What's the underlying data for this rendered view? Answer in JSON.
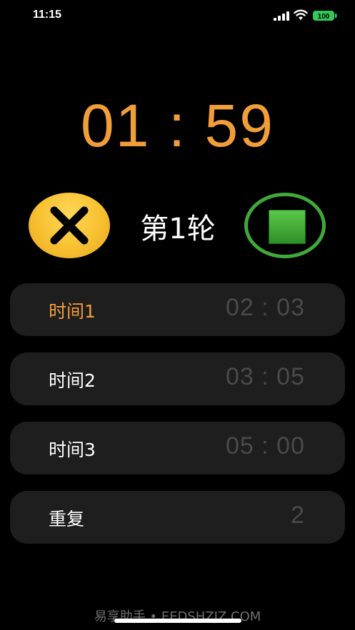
{
  "status_bar": {
    "time": "11:15",
    "battery_level": "100",
    "battery_color": "#34C759"
  },
  "timer": {
    "display": "01 : 59",
    "color": "#F29E38"
  },
  "round": {
    "label": "第1轮"
  },
  "controls": {
    "cancel_icon": "close-icon",
    "stop_icon": "stop-square-icon",
    "stop_color": "#3FA93A"
  },
  "settings": [
    {
      "label": "时间1",
      "value": "02 : 03",
      "active": true
    },
    {
      "label": "时间2",
      "value": "03 : 05",
      "active": false
    },
    {
      "label": "时间3",
      "value": "05 : 00",
      "active": false
    },
    {
      "label": "重复",
      "value": "2",
      "active": false
    }
  ],
  "watermark": "易享助手 • EEDSHZJZ.COM"
}
